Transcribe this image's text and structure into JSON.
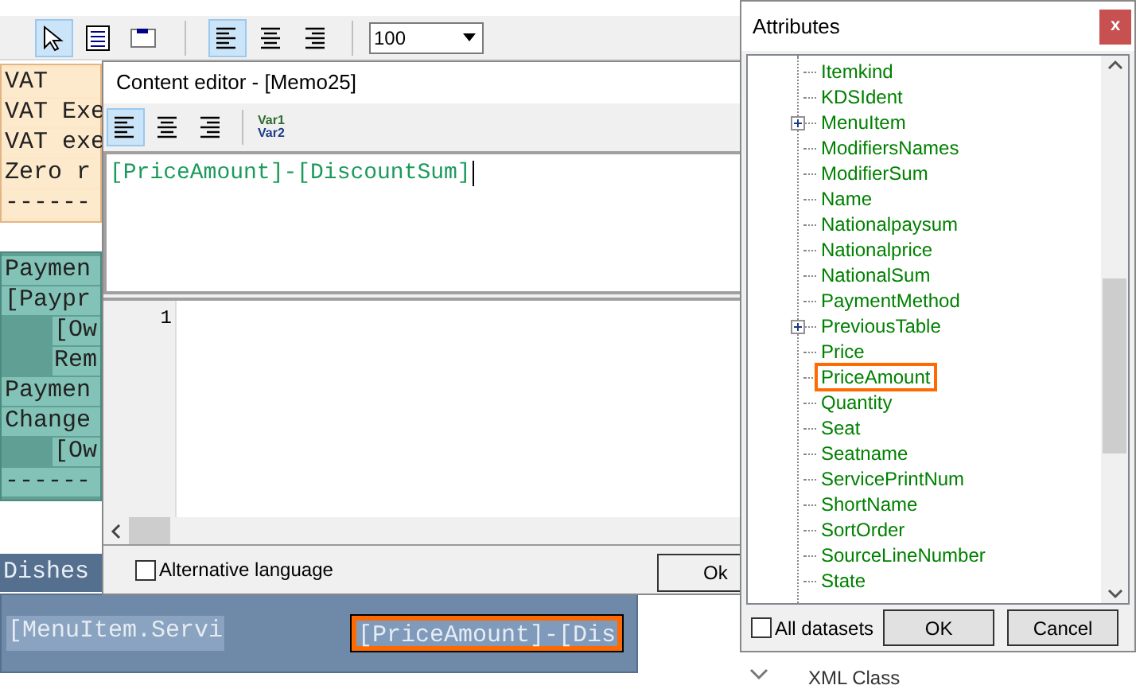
{
  "toolbar": {
    "tools": [
      {
        "kind": "pointer",
        "selected": true
      },
      {
        "kind": "memo",
        "selected": false
      },
      {
        "kind": "frame",
        "selected": false
      }
    ],
    "align": [
      {
        "kind": "left",
        "selected": true
      },
      {
        "kind": "center",
        "selected": false
      },
      {
        "kind": "right",
        "selected": false
      }
    ],
    "zoom": {
      "value": "100"
    }
  },
  "report": {
    "bands": [
      {
        "kind": "summary",
        "rows": [
          {
            "text": "VAT",
            "indent": false
          },
          {
            "text": "VAT Exe",
            "indent": false
          },
          {
            "text": "VAT exe",
            "indent": false
          },
          {
            "text": "Zero r",
            "indent": false
          },
          {
            "text": "------",
            "indent": false
          }
        ]
      },
      {
        "kind": "payment",
        "rows": [
          {
            "text": "Paymen",
            "indent": false
          },
          {
            "text": "[Paypr",
            "indent": false
          },
          {
            "text": "[Ow",
            "indent": true
          },
          {
            "text": "Rem",
            "indent": true
          },
          {
            "text": "Paymen",
            "indent": false
          },
          {
            "text": "Change",
            "indent": false
          },
          {
            "text": "[Ow",
            "indent": true
          },
          {
            "text": "------",
            "indent": false
          }
        ]
      },
      {
        "kind": "dishes",
        "title": "Dishes",
        "fields": [
          {
            "text": "[MenuItem.Servi",
            "highlighted": false
          },
          {
            "text": "[PriceAmount]-[Dis",
            "highlighted": true
          }
        ]
      }
    ]
  },
  "editor": {
    "title": "Content editor - [Memo25]",
    "align": [
      {
        "kind": "left",
        "selected": true
      },
      {
        "kind": "center",
        "selected": false
      },
      {
        "kind": "right",
        "selected": false
      }
    ],
    "var_button": {
      "line_1": "Var1",
      "line_2": "Var2"
    },
    "expression": "[PriceAmount]-[DiscountSum]",
    "line_numbers": [
      "1"
    ],
    "alt_language": {
      "label": "Alternative language",
      "checked": false
    },
    "ok_button": "Ok"
  },
  "attributes": {
    "title": "Attributes",
    "close": "x",
    "items": [
      {
        "label": "Itemkind",
        "expandable": false,
        "highlighted": false
      },
      {
        "label": "KDSIdent",
        "expandable": false,
        "highlighted": false
      },
      {
        "label": "MenuItem",
        "expandable": true,
        "highlighted": false
      },
      {
        "label": "ModifiersNames",
        "expandable": false,
        "highlighted": false
      },
      {
        "label": "ModifierSum",
        "expandable": false,
        "highlighted": false
      },
      {
        "label": "Name",
        "expandable": false,
        "highlighted": false
      },
      {
        "label": "Nationalpaysum",
        "expandable": false,
        "highlighted": false
      },
      {
        "label": "Nationalprice",
        "expandable": false,
        "highlighted": false
      },
      {
        "label": "NationalSum",
        "expandable": false,
        "highlighted": false
      },
      {
        "label": "PaymentMethod",
        "expandable": false,
        "highlighted": false
      },
      {
        "label": "PreviousTable",
        "expandable": true,
        "highlighted": false
      },
      {
        "label": "Price",
        "expandable": false,
        "highlighted": false
      },
      {
        "label": "PriceAmount",
        "expandable": false,
        "highlighted": true
      },
      {
        "label": "Quantity",
        "expandable": false,
        "highlighted": false
      },
      {
        "label": "Seat",
        "expandable": false,
        "highlighted": false
      },
      {
        "label": "Seatname",
        "expandable": false,
        "highlighted": false
      },
      {
        "label": "ServicePrintNum",
        "expandable": false,
        "highlighted": false
      },
      {
        "label": "ShortName",
        "expandable": false,
        "highlighted": false
      },
      {
        "label": "SortOrder",
        "expandable": false,
        "highlighted": false
      },
      {
        "label": "SourceLineNumber",
        "expandable": false,
        "highlighted": false
      },
      {
        "label": "State",
        "expandable": false,
        "highlighted": false
      }
    ],
    "all_datasets": {
      "label": "All datasets",
      "checked": false
    },
    "buttons": [
      "OK",
      "Cancel"
    ]
  },
  "background_label": "XML Class"
}
